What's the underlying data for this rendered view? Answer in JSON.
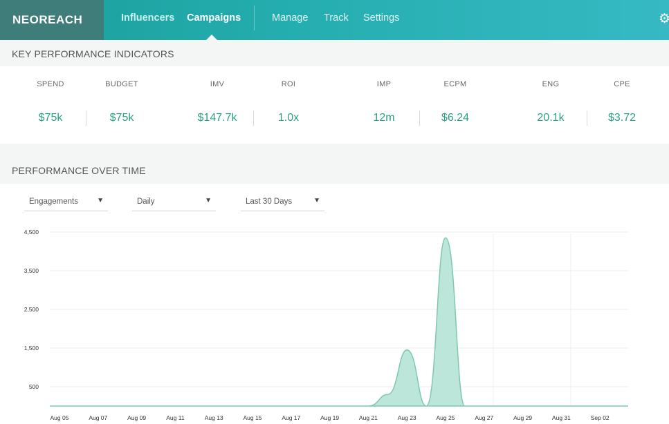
{
  "nav": {
    "logo": "NEOREACH",
    "items": [
      "Influencers",
      "Campaigns",
      "Manage",
      "Track",
      "Settings"
    ],
    "active": "Campaigns",
    "settings_icon": "gear-icon"
  },
  "kpi": {
    "title": "KEY PERFORMANCE INDICATORS",
    "metrics": [
      {
        "label": "SPEND",
        "value": "$75k"
      },
      {
        "label": "BUDGET",
        "value": "$75k"
      },
      {
        "label": "IMV",
        "value": "$147.7k"
      },
      {
        "label": "ROI",
        "value": "1.0x"
      },
      {
        "label": "IMP",
        "value": "12m"
      },
      {
        "label": "ECPM",
        "value": "$6.24"
      },
      {
        "label": "ENG",
        "value": "20.1k"
      },
      {
        "label": "CPE",
        "value": "$3.72"
      }
    ]
  },
  "performance": {
    "title": "PERFORMANCE OVER TIME",
    "filters": [
      {
        "value": "Engagements"
      },
      {
        "value": "Daily"
      },
      {
        "value": "Last 30 Days"
      }
    ]
  },
  "colors": {
    "accent": "#2aa084",
    "area_fill": "#b5e3d6",
    "area_stroke": "#7cc8b0"
  },
  "chart_data": {
    "type": "area",
    "x_tick_labels": [
      "Aug 05",
      "Aug 07",
      "Aug 09",
      "Aug 11",
      "Aug 13",
      "Aug 15",
      "Aug 17",
      "Aug 19",
      "Aug 21",
      "Aug 23",
      "Aug 25",
      "Aug 27",
      "Aug 29",
      "Aug 31",
      "Sep 02"
    ],
    "y_tick_labels": [
      "500",
      "1,500",
      "2,500",
      "3,500",
      "4,500"
    ],
    "y_ticks": [
      500,
      1500,
      2500,
      3500,
      4500
    ],
    "ylim": [
      0,
      4500
    ],
    "x": [
      "Aug 05",
      "Aug 06",
      "Aug 07",
      "Aug 08",
      "Aug 09",
      "Aug 10",
      "Aug 11",
      "Aug 12",
      "Aug 13",
      "Aug 14",
      "Aug 15",
      "Aug 16",
      "Aug 17",
      "Aug 18",
      "Aug 19",
      "Aug 20",
      "Aug 21",
      "Aug 22",
      "Aug 23",
      "Aug 24",
      "Aug 25",
      "Aug 26",
      "Aug 27",
      "Aug 28",
      "Aug 29",
      "Aug 30",
      "Aug 31",
      "Sep 01",
      "Sep 02",
      "Sep 03"
    ],
    "series": [
      {
        "values": [
          0,
          0,
          0,
          0,
          0,
          0,
          0,
          0,
          0,
          0,
          0,
          0,
          0,
          0,
          0,
          0,
          0,
          300,
          1450,
          0,
          4350,
          0,
          0,
          0,
          0,
          0,
          0,
          0,
          0,
          0
        ]
      }
    ],
    "grid": true
  }
}
